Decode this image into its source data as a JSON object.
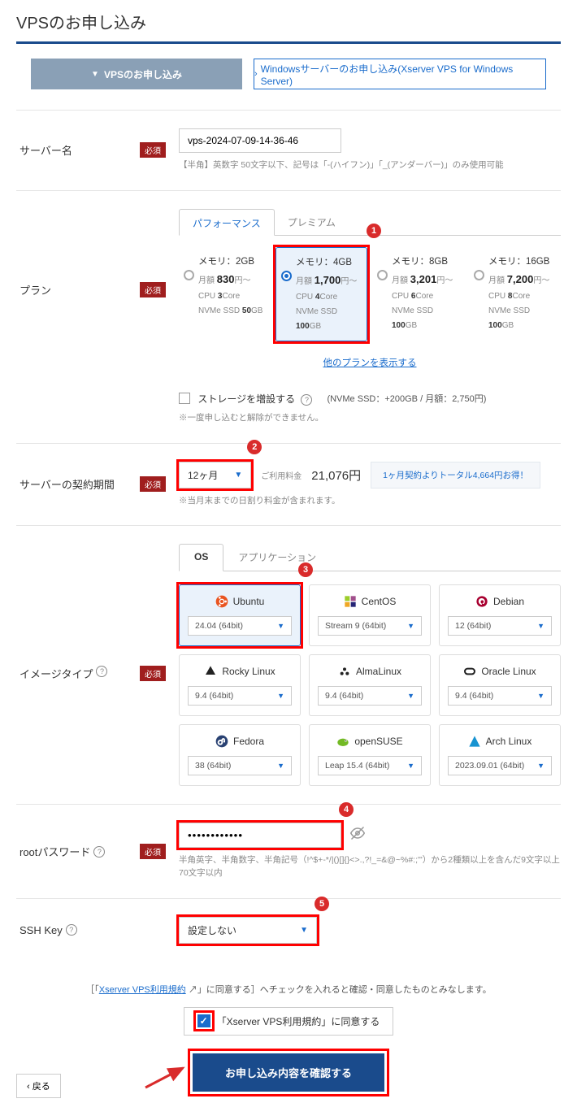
{
  "page_title": "VPSのお申し込み",
  "tabs": {
    "vps": "VPSのお申し込み",
    "windows": "Windowsサーバーのお申し込み(Xserver VPS for Windows Server)"
  },
  "server_name": {
    "label": "サーバー名",
    "required": "必須",
    "value": "vps-2024-07-09-14-36-46",
    "hint": "【半角】英数字 50文字以下、記号は「-(ハイフン)」「_(アンダーバー)」のみ使用可能"
  },
  "plan": {
    "label": "プラン",
    "required": "必須",
    "tabs": {
      "performance": "パフォーマンス",
      "premium": "プレミアム"
    },
    "cards": [
      {
        "title": "メモリ：2GB",
        "price_label": "月額",
        "price": "830",
        "price_suffix": "円〜",
        "cpu_label": "CPU",
        "cpu": "3",
        "cpu_suffix": "Core",
        "ssd_label": "NVMe SSD",
        "ssd": "50",
        "ssd_suffix": "GB",
        "selected": false
      },
      {
        "title": "メモリ：4GB",
        "price_label": "月額",
        "price": "1,700",
        "price_suffix": "円〜",
        "cpu_label": "CPU",
        "cpu": "4",
        "cpu_suffix": "Core",
        "ssd_label": "NVMe SSD",
        "ssd": "100",
        "ssd_suffix": "GB",
        "selected": true
      },
      {
        "title": "メモリ：8GB",
        "price_label": "月額",
        "price": "3,201",
        "price_suffix": "円〜",
        "cpu_label": "CPU",
        "cpu": "6",
        "cpu_suffix": "Core",
        "ssd_label": "NVMe SSD",
        "ssd": "100",
        "ssd_suffix": "GB",
        "selected": false
      },
      {
        "title": "メモリ：16GB",
        "price_label": "月額",
        "price": "7,200",
        "price_suffix": "円〜",
        "cpu_label": "CPU",
        "cpu": "8",
        "cpu_suffix": "Core",
        "ssd_label": "NVMe SSD",
        "ssd": "100",
        "ssd_suffix": "GB",
        "selected": false
      }
    ],
    "show_more": "他のプランを表示する",
    "storage": {
      "cb_label": "ストレージを増設する",
      "info": "(NVMe SSD：+200GB / 月額：2,750円)"
    },
    "storage_note": "※一度申し込むと解除ができません。"
  },
  "term": {
    "label": "サーバーの契約期間",
    "required": "必須",
    "value": "12ヶ月",
    "fee_label": "ご利用料金",
    "fee_value": "21,076円",
    "promo": "1ヶ月契約よりトータル4,664円お得！",
    "hint": "※当月末までの日割り料金が含まれます。"
  },
  "image": {
    "label": "イメージタイプ",
    "required": "必須",
    "tabs": {
      "os": "OS",
      "app": "アプリケーション"
    },
    "os": [
      {
        "name": "Ubuntu",
        "ver": "24.04 (64bit)",
        "selected": true,
        "icon": "ubuntu"
      },
      {
        "name": "CentOS",
        "ver": "Stream 9 (64bit)",
        "selected": false,
        "icon": "centos"
      },
      {
        "name": "Debian",
        "ver": "12 (64bit)",
        "selected": false,
        "icon": "debian"
      },
      {
        "name": "Rocky Linux",
        "ver": "9.4 (64bit)",
        "selected": false,
        "icon": "rocky"
      },
      {
        "name": "AlmaLinux",
        "ver": "9.4 (64bit)",
        "selected": false,
        "icon": "alma"
      },
      {
        "name": "Oracle Linux",
        "ver": "9.4 (64bit)",
        "selected": false,
        "icon": "oracle"
      },
      {
        "name": "Fedora",
        "ver": "38 (64bit)",
        "selected": false,
        "icon": "fedora"
      },
      {
        "name": "openSUSE",
        "ver": "Leap 15.4 (64bit)",
        "selected": false,
        "icon": "suse"
      },
      {
        "name": "Arch Linux",
        "ver": "2023.09.01 (64bit)",
        "selected": false,
        "icon": "arch"
      }
    ]
  },
  "root_pw": {
    "label": "rootパスワード",
    "required": "必須",
    "value": "••••••••••••",
    "hint": "半角英字、半角数字、半角記号（!^$+-*/|()[]{}<>.,?!_=&@~%#:;'\"）から2種類以上を含んだ9文字以上70文字以内"
  },
  "ssh": {
    "label": "SSH Key",
    "value": "設定しない"
  },
  "terms": {
    "line_pre": "［「",
    "link": "Xserver VPS利用規約",
    "ext_icon": "↗",
    "line_post": "」に同意する］へチェックを入れると確認・同意したものとみなします。",
    "cb_label": "「Xserver VPS利用規約」に同意する"
  },
  "submit": "お申し込み内容を確認する",
  "back": "戻る",
  "badges": {
    "b1": "1",
    "b2": "2",
    "b3": "3",
    "b4": "4",
    "b5": "5"
  }
}
